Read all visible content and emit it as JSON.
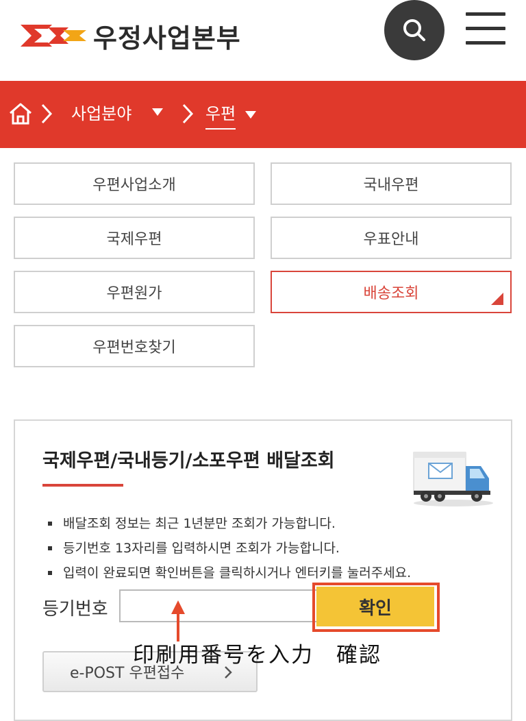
{
  "header": {
    "logo_text": "우정사업본부",
    "search_icon": "search-icon",
    "menu_icon": "hamburger-menu-icon"
  },
  "breadcrumb": {
    "home_icon": "home-icon",
    "items": [
      {
        "label": "사업분야",
        "has_dropdown": true
      },
      {
        "label": "우편",
        "has_dropdown": true
      }
    ]
  },
  "menu": {
    "items": [
      {
        "label": "우편사업소개",
        "active": false
      },
      {
        "label": "국내우편",
        "active": false
      },
      {
        "label": "국제우편",
        "active": false
      },
      {
        "label": "우표안내",
        "active": false
      },
      {
        "label": "우편원가",
        "active": false
      },
      {
        "label": "배송조회",
        "active": true
      },
      {
        "label": "우편번호찾기",
        "active": false
      }
    ]
  },
  "tracking": {
    "title": "국제우편/국내등기/소포우편 배달조회",
    "truck_icon": "delivery-truck-icon",
    "notes": [
      "배달조회 정보는 최근 1년분만 조회가 가능합니다.",
      "등기번호 13자리를 입력하시면 조회가 가능합니다.",
      "입력이 완료되면 확인버튼을 클릭하시거나 엔터키를 눌러주세요."
    ],
    "input_label": "등기번호",
    "input_value": "",
    "confirm_label": "확인",
    "annotation": "印刷用番号を入力　確認",
    "epost_label": "e-POST 우편접수"
  },
  "colors": {
    "brand_red": "#e0392b",
    "active_red": "#d9453a",
    "confirm_yellow": "#f4c436",
    "highlight_orange": "#e54a2c"
  }
}
